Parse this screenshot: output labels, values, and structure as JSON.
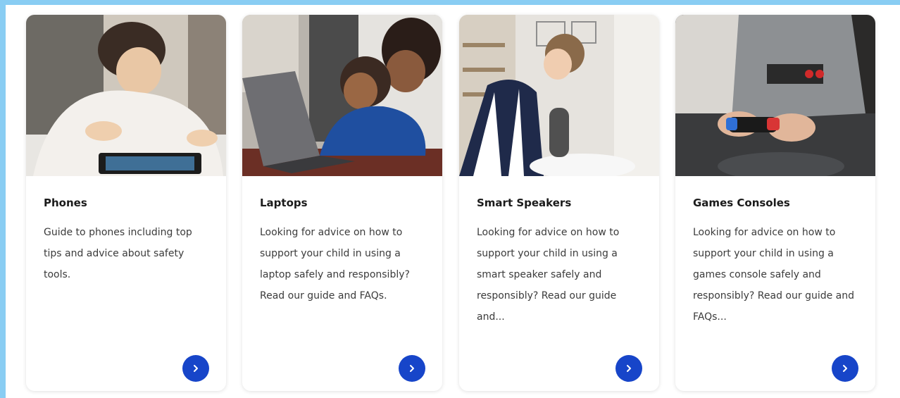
{
  "cards": [
    {
      "title": "Phones",
      "description": "Guide to phones including top tips and advice about safety tools."
    },
    {
      "title": "Laptops",
      "description": "Looking for advice on how to support your child in using a laptop safely and responsibly? Read our guide and FAQs."
    },
    {
      "title": "Smart Speakers",
      "description": "Looking for advice on how to support your child in using a smart speaker safely and responsibly? Read our guide and..."
    },
    {
      "title": "Games Consoles",
      "description": "Looking for advice on how to support your child in using a games console safely and responsibly? Read our guide and FAQs..."
    }
  ],
  "icons": {
    "arrow": "chevron-right-icon"
  },
  "colors": {
    "accent": "#1745c9",
    "frame": "#89cdf3"
  }
}
